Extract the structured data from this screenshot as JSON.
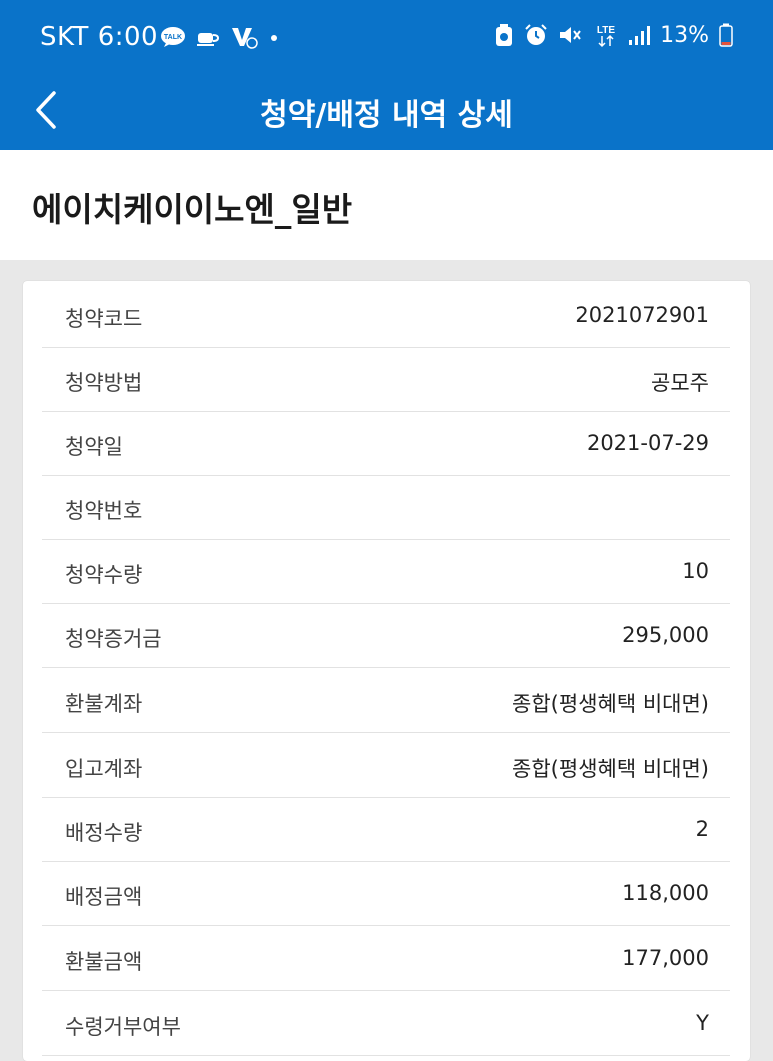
{
  "status_bar": {
    "carrier": "SKT",
    "time": "6:00",
    "network": "LTE",
    "battery": "13%",
    "notification_icons": [
      "talk-icon",
      "coffee-icon",
      "v-icon",
      "dot-icon"
    ],
    "system_icons": [
      "battery-saver-icon",
      "alarm-icon",
      "mute-icon",
      "lte-icon",
      "signal-icon",
      "battery-icon"
    ]
  },
  "nav": {
    "title": "청약/배정 내역 상세"
  },
  "item": {
    "title": "에이치케이이노엔_일반"
  },
  "details": [
    {
      "label": "청약코드",
      "value": "2021072901"
    },
    {
      "label": "청약방법",
      "value": "공모주"
    },
    {
      "label": "청약일",
      "value": "2021-07-29"
    },
    {
      "label": "청약번호",
      "value": ""
    },
    {
      "label": "청약수량",
      "value": "10"
    },
    {
      "label": "청약증거금",
      "value": "295,000"
    },
    {
      "label": "환불계좌",
      "value": "종합(평생혜택 비대면)"
    },
    {
      "label": "입고계좌",
      "value": "종합(평생혜택 비대면)"
    },
    {
      "label": "배정수량",
      "value": "2"
    },
    {
      "label": "배정금액",
      "value": "118,000"
    },
    {
      "label": "환불금액",
      "value": "177,000"
    },
    {
      "label": "수령거부여부",
      "value": "Y"
    }
  ],
  "colors": {
    "header": "#0a73c9",
    "background": "#e8e8e8",
    "card": "#ffffff",
    "divider": "#e2e2e2"
  }
}
